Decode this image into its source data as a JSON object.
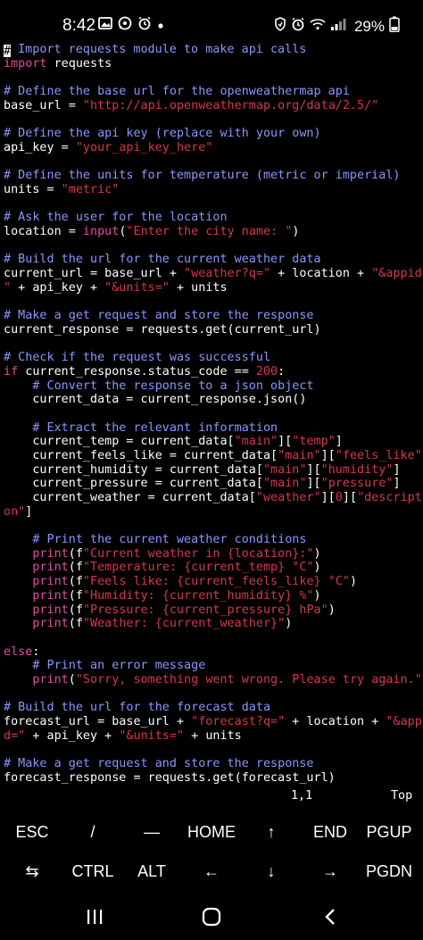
{
  "status": {
    "time": "8:42",
    "battery": "29%",
    "left_icons": [
      "gallery-icon",
      "whatsapp-icon",
      "alarm-icon",
      "dot-icon"
    ],
    "right_icons": [
      "battery-saver-icon",
      "alarm-icon",
      "wifi-icon",
      "signal-icon"
    ]
  },
  "code": [
    [
      [
        "cm",
        "# Import requests module to make api calls"
      ]
    ],
    [
      [
        "kw",
        "import"
      ],
      [
        "fn",
        " requests"
      ]
    ],
    [],
    [
      [
        "cm",
        "# Define the base url for the openweathermap api"
      ]
    ],
    [
      [
        "fn",
        "base_url = "
      ],
      [
        "st",
        "\"http://api.openweathermap.org/data/2.5/\""
      ]
    ],
    [],
    [
      [
        "cm",
        "# Define the api key (replace with your own)"
      ]
    ],
    [
      [
        "fn",
        "api_key = "
      ],
      [
        "st",
        "\"your_api_key_here\""
      ]
    ],
    [],
    [
      [
        "cm",
        "# Define the units for temperature (metric or imperial)"
      ]
    ],
    [
      [
        "fn",
        "units = "
      ],
      [
        "st",
        "\"metric\""
      ]
    ],
    [],
    [
      [
        "cm",
        "# Ask the user for the location"
      ]
    ],
    [
      [
        "fn",
        "location = "
      ],
      [
        "kw",
        "input"
      ],
      [
        "fn",
        "("
      ],
      [
        "st",
        "\"Enter the city name: \""
      ],
      [
        "fn",
        ")"
      ]
    ],
    [],
    [
      [
        "cm",
        "# Build the url for the current weather data"
      ]
    ],
    [
      [
        "fn",
        "current_url = base_url + "
      ],
      [
        "st",
        "\"weather?q=\""
      ],
      [
        "fn",
        " + location + "
      ],
      [
        "st",
        "\"&appid="
      ]
    ],
    [
      [
        "st",
        "\""
      ],
      [
        "fn",
        " + api_key + "
      ],
      [
        "st",
        "\"&units=\""
      ],
      [
        "fn",
        " + units"
      ]
    ],
    [],
    [
      [
        "cm",
        "# Make a get request and store the response"
      ]
    ],
    [
      [
        "fn",
        "current_response = requests.get(current_url)"
      ]
    ],
    [],
    [
      [
        "cm",
        "# Check if the request was successful"
      ]
    ],
    [
      [
        "kw",
        "if"
      ],
      [
        "fn",
        " current_response.status_code == "
      ],
      [
        "st",
        "200"
      ],
      [
        "fn",
        ":"
      ]
    ],
    [
      [
        "fn",
        "    "
      ],
      [
        "cm",
        "# Convert the response to a json object"
      ]
    ],
    [
      [
        "fn",
        "    current_data = current_response.json()"
      ]
    ],
    [],
    [
      [
        "fn",
        "    "
      ],
      [
        "cm",
        "# Extract the relevant information"
      ]
    ],
    [
      [
        "fn",
        "    current_temp = current_data["
      ],
      [
        "st",
        "\"main\""
      ],
      [
        "fn",
        "]["
      ],
      [
        "st",
        "\"temp\""
      ],
      [
        "fn",
        "]"
      ]
    ],
    [
      [
        "fn",
        "    current_feels_like = current_data["
      ],
      [
        "st",
        "\"main\""
      ],
      [
        "fn",
        "]["
      ],
      [
        "st",
        "\"feels_like\""
      ],
      [
        "fn",
        "]"
      ]
    ],
    [
      [
        "fn",
        "    current_humidity = current_data["
      ],
      [
        "st",
        "\"main\""
      ],
      [
        "fn",
        "]["
      ],
      [
        "st",
        "\"humidity\""
      ],
      [
        "fn",
        "]"
      ]
    ],
    [
      [
        "fn",
        "    current_pressure = current_data["
      ],
      [
        "st",
        "\"main\""
      ],
      [
        "fn",
        "]["
      ],
      [
        "st",
        "\"pressure\""
      ],
      [
        "fn",
        "]"
      ]
    ],
    [
      [
        "fn",
        "    current_weather = current_data["
      ],
      [
        "st",
        "\"weather\""
      ],
      [
        "fn",
        "]["
      ],
      [
        "st",
        "0"
      ],
      [
        "fn",
        "]["
      ],
      [
        "st",
        "\"descripti"
      ]
    ],
    [
      [
        "st",
        "on\""
      ],
      [
        "fn",
        "]"
      ]
    ],
    [],
    [
      [
        "fn",
        "    "
      ],
      [
        "cm",
        "# Print the current weather conditions"
      ]
    ],
    [
      [
        "fn",
        "    "
      ],
      [
        "kw",
        "print"
      ],
      [
        "fn",
        "(f"
      ],
      [
        "st",
        "\"Current weather in {location}:\""
      ],
      [
        "fn",
        ")"
      ]
    ],
    [
      [
        "fn",
        "    "
      ],
      [
        "kw",
        "print"
      ],
      [
        "fn",
        "(f"
      ],
      [
        "st",
        "\"Temperature: {current_temp} °C\""
      ],
      [
        "fn",
        ")"
      ]
    ],
    [
      [
        "fn",
        "    "
      ],
      [
        "kw",
        "print"
      ],
      [
        "fn",
        "(f"
      ],
      [
        "st",
        "\"Feels like: {current_feels_like} °C\""
      ],
      [
        "fn",
        ")"
      ]
    ],
    [
      [
        "fn",
        "    "
      ],
      [
        "kw",
        "print"
      ],
      [
        "fn",
        "(f"
      ],
      [
        "st",
        "\"Humidity: {current_humidity} %\""
      ],
      [
        "fn",
        ")"
      ]
    ],
    [
      [
        "fn",
        "    "
      ],
      [
        "kw",
        "print"
      ],
      [
        "fn",
        "(f"
      ],
      [
        "st",
        "\"Pressure: {current_pressure} hPa\""
      ],
      [
        "fn",
        ")"
      ]
    ],
    [
      [
        "fn",
        "    "
      ],
      [
        "kw",
        "print"
      ],
      [
        "fn",
        "(f"
      ],
      [
        "st",
        "\"Weather: {current_weather}\""
      ],
      [
        "fn",
        ")"
      ]
    ],
    [],
    [
      [
        "kw",
        "else"
      ],
      [
        "fn",
        ":"
      ]
    ],
    [
      [
        "fn",
        "    "
      ],
      [
        "cm",
        "# Print an error message"
      ]
    ],
    [
      [
        "fn",
        "    "
      ],
      [
        "kw",
        "print"
      ],
      [
        "fn",
        "("
      ],
      [
        "st",
        "\"Sorry, something went wrong. Please try again.\""
      ],
      [
        "fn",
        ")"
      ]
    ],
    [],
    [
      [
        "cm",
        "# Build the url for the forecast data"
      ]
    ],
    [
      [
        "fn",
        "forecast_url = base_url + "
      ],
      [
        "st",
        "\"forecast?q=\""
      ],
      [
        "fn",
        " + location + "
      ],
      [
        "st",
        "\"&appi"
      ]
    ],
    [
      [
        "st",
        "d=\""
      ],
      [
        "fn",
        " + api_key + "
      ],
      [
        "st",
        "\"&units=\""
      ],
      [
        "fn",
        " + units"
      ]
    ],
    [],
    [
      [
        "cm",
        "# Make a get request and store the response"
      ]
    ],
    [
      [
        "fn",
        "forecast_response = requests.get(forecast_url)"
      ]
    ]
  ],
  "ruler": {
    "position": "1,1",
    "scroll": "Top"
  },
  "extra_keys": {
    "row1": [
      "ESC",
      "/",
      "—",
      "HOME",
      "↑",
      "END",
      "PGUP"
    ],
    "row2": [
      "⇆",
      "CTRL",
      "ALT",
      "←",
      "↓",
      "→",
      "PGDN"
    ]
  },
  "navbar": [
    "recents-icon",
    "home-icon",
    "back-icon"
  ]
}
